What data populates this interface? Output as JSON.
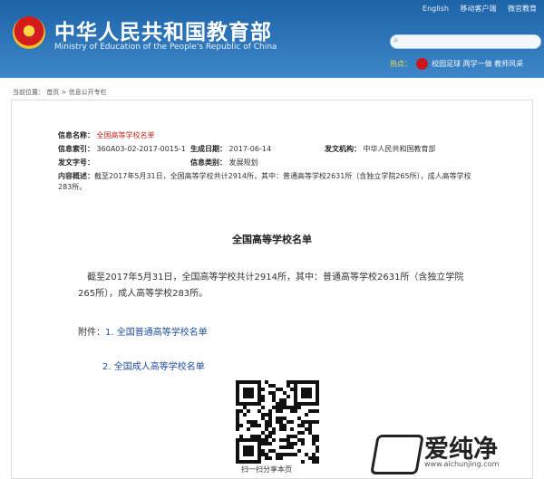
{
  "header": {
    "title_cn": "中华人民共和国教育部",
    "title_en": "Ministry of Education of the People's Republic of China",
    "top_links": [
      "English",
      "移动客户端",
      "微官教育"
    ],
    "hot_label": "热点：",
    "hot_links": [
      "校园足球",
      "两学一做",
      "教师风采"
    ],
    "brand_color": "#2a6db5"
  },
  "breadcrumb": {
    "prefix": "当前位置：",
    "home": "首页",
    "sep": ">",
    "section": "信息公开专栏"
  },
  "meta": {
    "name_label": "信息名称：",
    "name_value": "全国高等学校名单",
    "index_label": "信息索引：",
    "index_value": "360A03-02-2017-0015-1",
    "date_label": "生成日期：",
    "date_value": "2017-06-14",
    "org_label": "发文机构：",
    "org_value": "中华人民共和国教育部",
    "docno_label": "发文字号：",
    "category_label": "信息类别：",
    "category_value": "发展规划",
    "abstract_label": "内容概述：",
    "abstract_value": "截至2017年5月31日，全国高等学校共计2914所，其中：普通高等学校2631所（含独立学院265所），成人高等学校283所。"
  },
  "document": {
    "title": "全国高等学校名单",
    "paragraph": "截至2017年5月31日，全国高等学校共计2914所，其中：普通高等学校2631所（含独立学院265所），成人高等学校283所。",
    "attach_label": "附件：",
    "attachments": [
      "1. 全国普通高等学校名单",
      "2. 全国成人高等学校名单"
    ],
    "qr_caption": "扫一扫分享本页"
  },
  "watermark": {
    "text": "爱纯净",
    "url": "www.aichunjing.com"
  }
}
